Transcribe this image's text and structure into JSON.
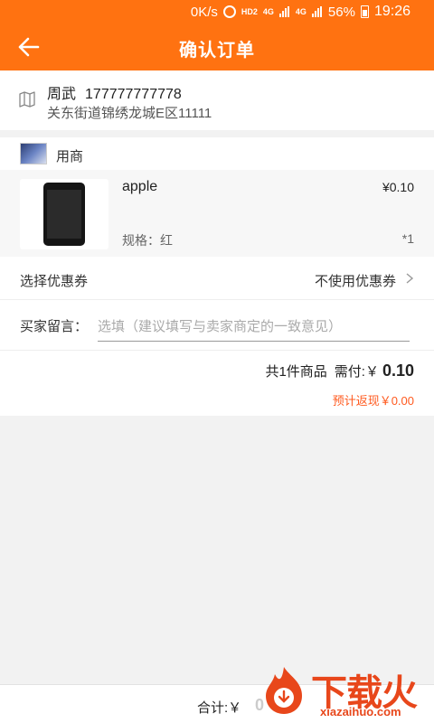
{
  "status_bar": {
    "speed": "0K/s",
    "hd": "HD2",
    "net1": "4G",
    "net2": "4G",
    "battery": "56%",
    "time": "19:26"
  },
  "header": {
    "title": "确认订单"
  },
  "address": {
    "name": "周武",
    "phone": "177777777778",
    "detail": "关东街道锦绣龙城E区11111"
  },
  "shop": {
    "name": "用商"
  },
  "product": {
    "name": "apple",
    "price": "¥0.10",
    "spec": "规格：红",
    "quantity": "*1"
  },
  "coupon": {
    "label": "选择优惠券",
    "value": "不使用优惠券"
  },
  "message": {
    "label": "买家留言：",
    "placeholder": "选填（建议填写与卖家商定的一致意见）"
  },
  "summary": {
    "items_text": "共1件商品",
    "pay_label": "需付:￥",
    "pay_amount": "0.10",
    "cashback": "预计返现￥0.00"
  },
  "bottom": {
    "total_label": "合计:￥",
    "total_value": "0"
  },
  "watermark": {
    "text": "下载火",
    "url": "xiazaihuo.com"
  },
  "colors": {
    "accent": "#ff7211",
    "cashback": "#ff5a1f",
    "watermark": "#e8471b"
  }
}
